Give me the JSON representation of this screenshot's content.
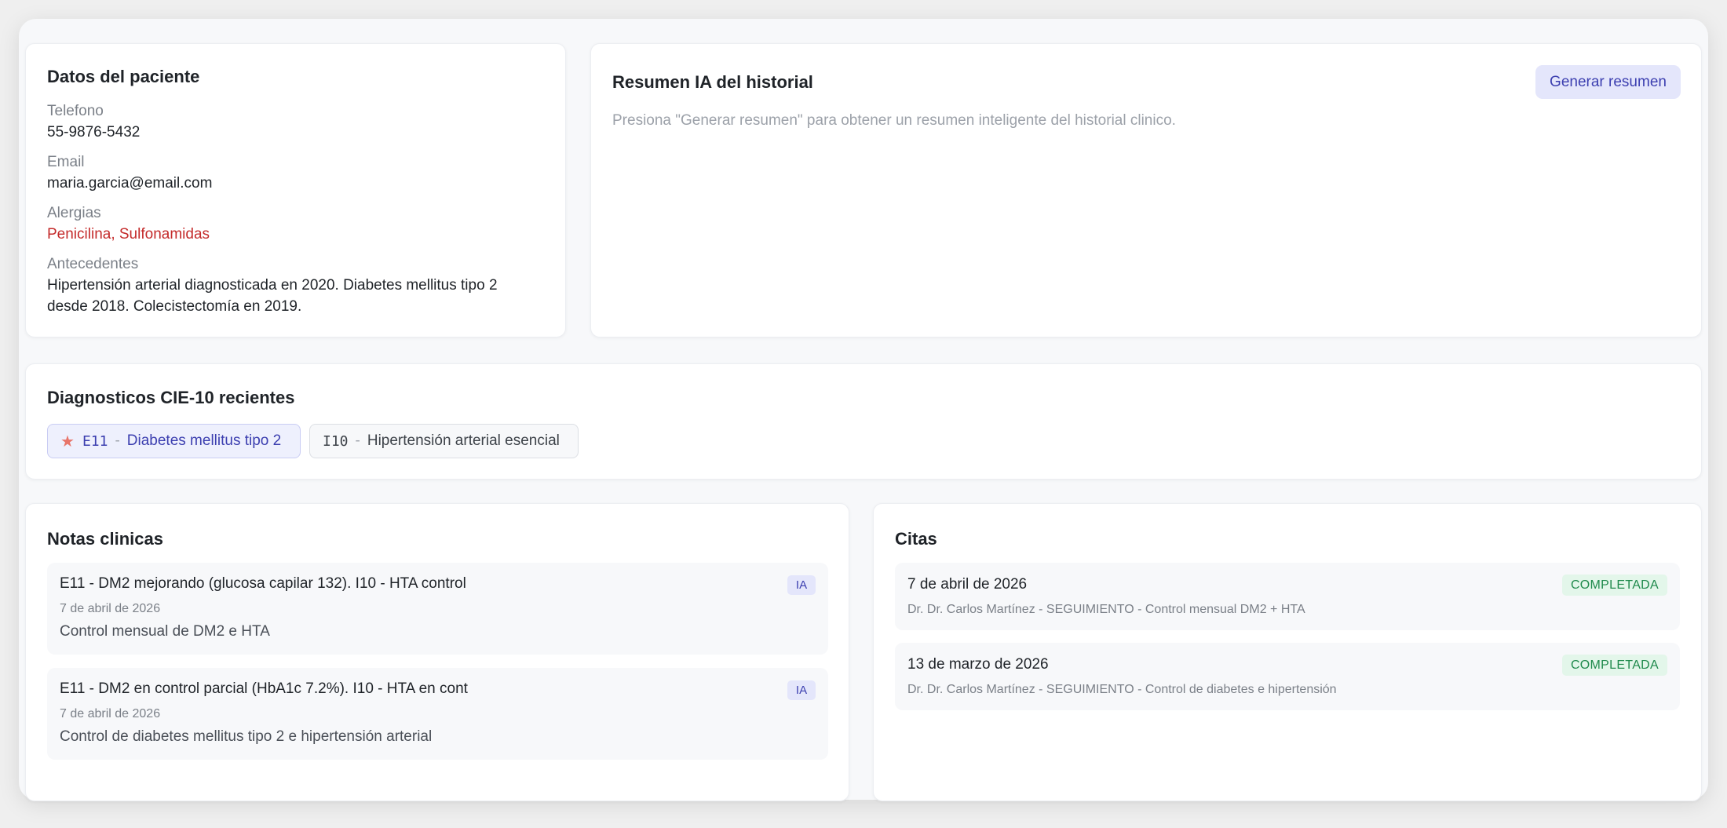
{
  "patient": {
    "title": "Datos del paciente",
    "phone_label": "Telefono",
    "phone": "55-9876-5432",
    "email_label": "Email",
    "email": "maria.garcia@email.com",
    "allergies_label": "Alergias",
    "allergies": "Penicilina, Sulfonamidas",
    "history_label": "Antecedentes",
    "history": "Hipertensión arterial diagnosticada en 2020. Diabetes mellitus tipo 2 desde 2018. Colecistectomía en 2019."
  },
  "summary": {
    "title": "Resumen IA del historial",
    "button": "Generar resumen",
    "hint": "Presiona \"Generar resumen\" para obtener un resumen inteligente del historial clinico."
  },
  "diagnoses": {
    "title": "Diagnosticos CIE-10 recientes",
    "sep": "-",
    "items": [
      {
        "code": "E11",
        "name": "Diabetes mellitus tipo 2",
        "primary": true
      },
      {
        "code": "I10",
        "name": "Hipertensión arterial esencial",
        "primary": false
      }
    ]
  },
  "notes": {
    "title": "Notas clinicas",
    "items": [
      {
        "title": "E11 - DM2 mejorando (glucosa capilar 132). I10 - HTA control",
        "date": "7 de abril de 2026",
        "body": "Control mensual de DM2 e HTA",
        "badge": "IA"
      },
      {
        "title": "E11 - DM2 en control parcial (HbA1c 7.2%). I10 - HTA en cont",
        "date": "7 de abril de 2026",
        "body": "Control de diabetes mellitus tipo 2 e hipertensión arterial",
        "badge": "IA"
      }
    ]
  },
  "appointments": {
    "title": "Citas",
    "items": [
      {
        "date": "7 de abril de 2026",
        "detail": "Dr. Dr. Carlos Martínez - SEGUIMIENTO - Control mensual DM2 + HTA",
        "status": "COMPLETADA"
      },
      {
        "date": "13 de marzo de 2026",
        "detail": "Dr. Dr. Carlos Martínez - SEGUIMIENTO - Control de diabetes e hipertensión",
        "status": "COMPLETADA"
      }
    ]
  },
  "colors": {
    "accent": "#3c3fb0",
    "allergy": "#c42b2b",
    "status_completed": "#1f8a4c"
  }
}
